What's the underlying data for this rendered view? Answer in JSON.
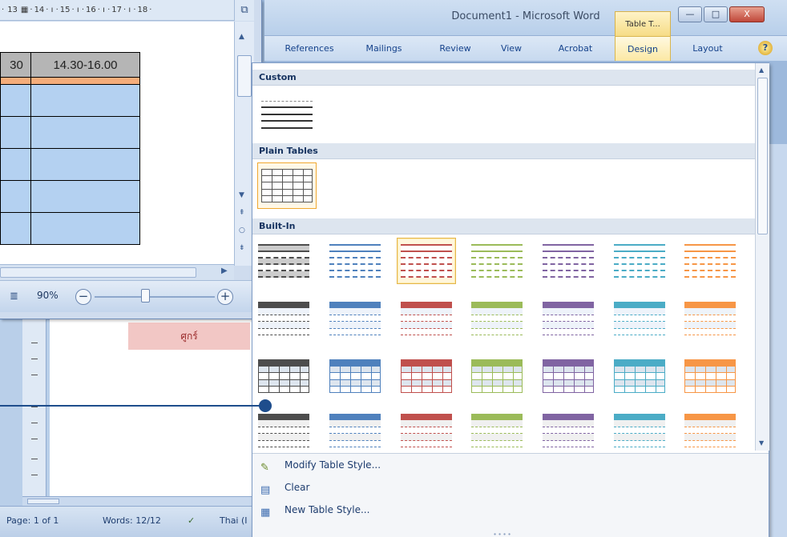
{
  "preview": {
    "ruler_marks": [
      "13",
      "14",
      "15",
      "16",
      "17",
      "18"
    ],
    "table_header": [
      "30",
      "14.30-16.00"
    ],
    "zoom": "90%",
    "zoom_minus": "−",
    "zoom_plus": "+"
  },
  "background": {
    "thai_cell_text": "ศูกร์",
    "status_page": "Page: 1 of 1",
    "status_words": "Words: 12/12",
    "status_lang": "Thai (I"
  },
  "window": {
    "title": "Document1 - Microsoft Word",
    "context_tab": "Table T...",
    "minimize": "—",
    "maximize": "□",
    "close": "X"
  },
  "tabs": [
    {
      "label": "References",
      "active": false
    },
    {
      "label": "Mailings",
      "active": false
    },
    {
      "label": "Review",
      "active": false
    },
    {
      "label": "View",
      "active": false
    },
    {
      "label": "Acrobat",
      "active": false
    },
    {
      "label": "Design",
      "active": true
    },
    {
      "label": "Layout",
      "active": false
    }
  ],
  "gallery": {
    "sections": [
      "Custom",
      "Plain Tables",
      "Built-In"
    ],
    "selected_style_row": 0,
    "selected_style_col": 2,
    "builtin_colors": [
      "#4d4d4d",
      "#4f81bd",
      "#c0504d",
      "#9bbb59",
      "#8064a2",
      "#4bacc6",
      "#f79646"
    ],
    "menu": [
      {
        "label": "Modify Table Style...",
        "icon": "modify-table-style-icon"
      },
      {
        "label": "Clear",
        "icon": "clear-table-icon"
      },
      {
        "label": "New Table Style...",
        "icon": "new-table-style-icon"
      }
    ]
  }
}
